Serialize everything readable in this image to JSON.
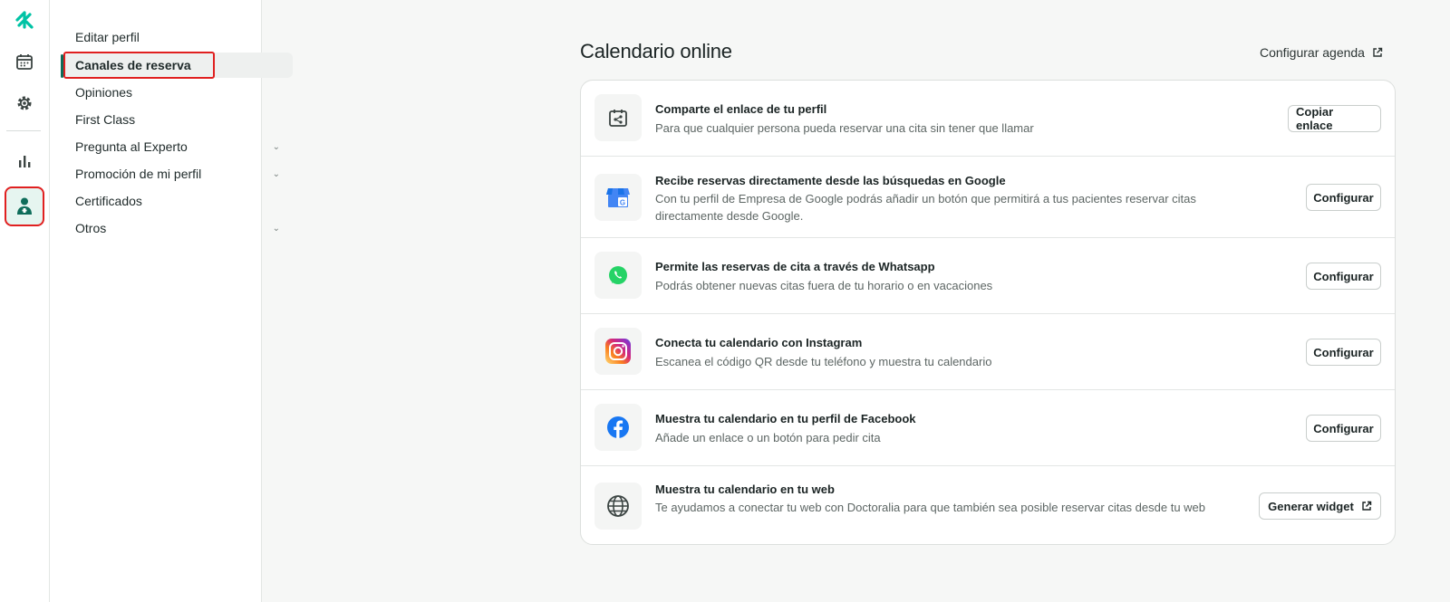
{
  "rail": {
    "icons": [
      "doctoralia-logo-icon",
      "calendar-icon",
      "gear-icon",
      "bar-chart-icon",
      "doctor-profile-icon"
    ]
  },
  "subnav": {
    "items": [
      {
        "label": "Editar perfil",
        "expandable": false
      },
      {
        "label": "Canales de reserva",
        "expandable": false,
        "active": true
      },
      {
        "label": "Opiniones",
        "expandable": false
      },
      {
        "label": "First Class",
        "expandable": false
      },
      {
        "label": "Pregunta al Experto",
        "expandable": true
      },
      {
        "label": "Promoción de mi perfil",
        "expandable": true
      },
      {
        "label": "Certificados",
        "expandable": false
      },
      {
        "label": "Otros",
        "expandable": true
      }
    ]
  },
  "main": {
    "title": "Calendario online",
    "config_link": "Configurar agenda",
    "rows": [
      {
        "icon": "share-calendar-icon",
        "title": "Comparte el enlace de tu perfil",
        "desc": "Para que cualquier persona pueda reservar una cita sin tener que llamar",
        "button": "Copiar enlace"
      },
      {
        "icon": "google-business-icon",
        "title": "Recibe reservas directamente desde las búsquedas en Google",
        "desc": "Con tu perfil de Empresa de Google podrás añadir un botón que permitirá a tus pacientes reservar citas directamente desde Google.",
        "button": "Configurar"
      },
      {
        "icon": "whatsapp-icon",
        "title": "Permite las reservas de cita a través de Whatsapp",
        "desc": "Podrás obtener nuevas citas fuera de tu horario o en vacaciones",
        "button": "Configurar"
      },
      {
        "icon": "instagram-icon",
        "title": "Conecta tu calendario con Instagram",
        "desc": "Escanea el código QR desde tu teléfono y muestra tu calendario",
        "button": "Configurar"
      },
      {
        "icon": "facebook-icon",
        "title": "Muestra tu calendario en tu perfil de Facebook",
        "desc": "Añade un enlace o un botón para pedir cita",
        "button": "Configurar"
      },
      {
        "icon": "globe-icon",
        "title": "Muestra tu calendario en tu web",
        "desc": "Te ayudamos a conectar tu web con Doctoralia para que también sea posible reservar citas desde tu web",
        "button": "Generar widget"
      }
    ]
  },
  "colors": {
    "brand": "#00c3a5",
    "active_bar": "#0e6d5a",
    "highlight": "#e02020",
    "whatsapp": "#25d366",
    "facebook": "#1877f2"
  }
}
